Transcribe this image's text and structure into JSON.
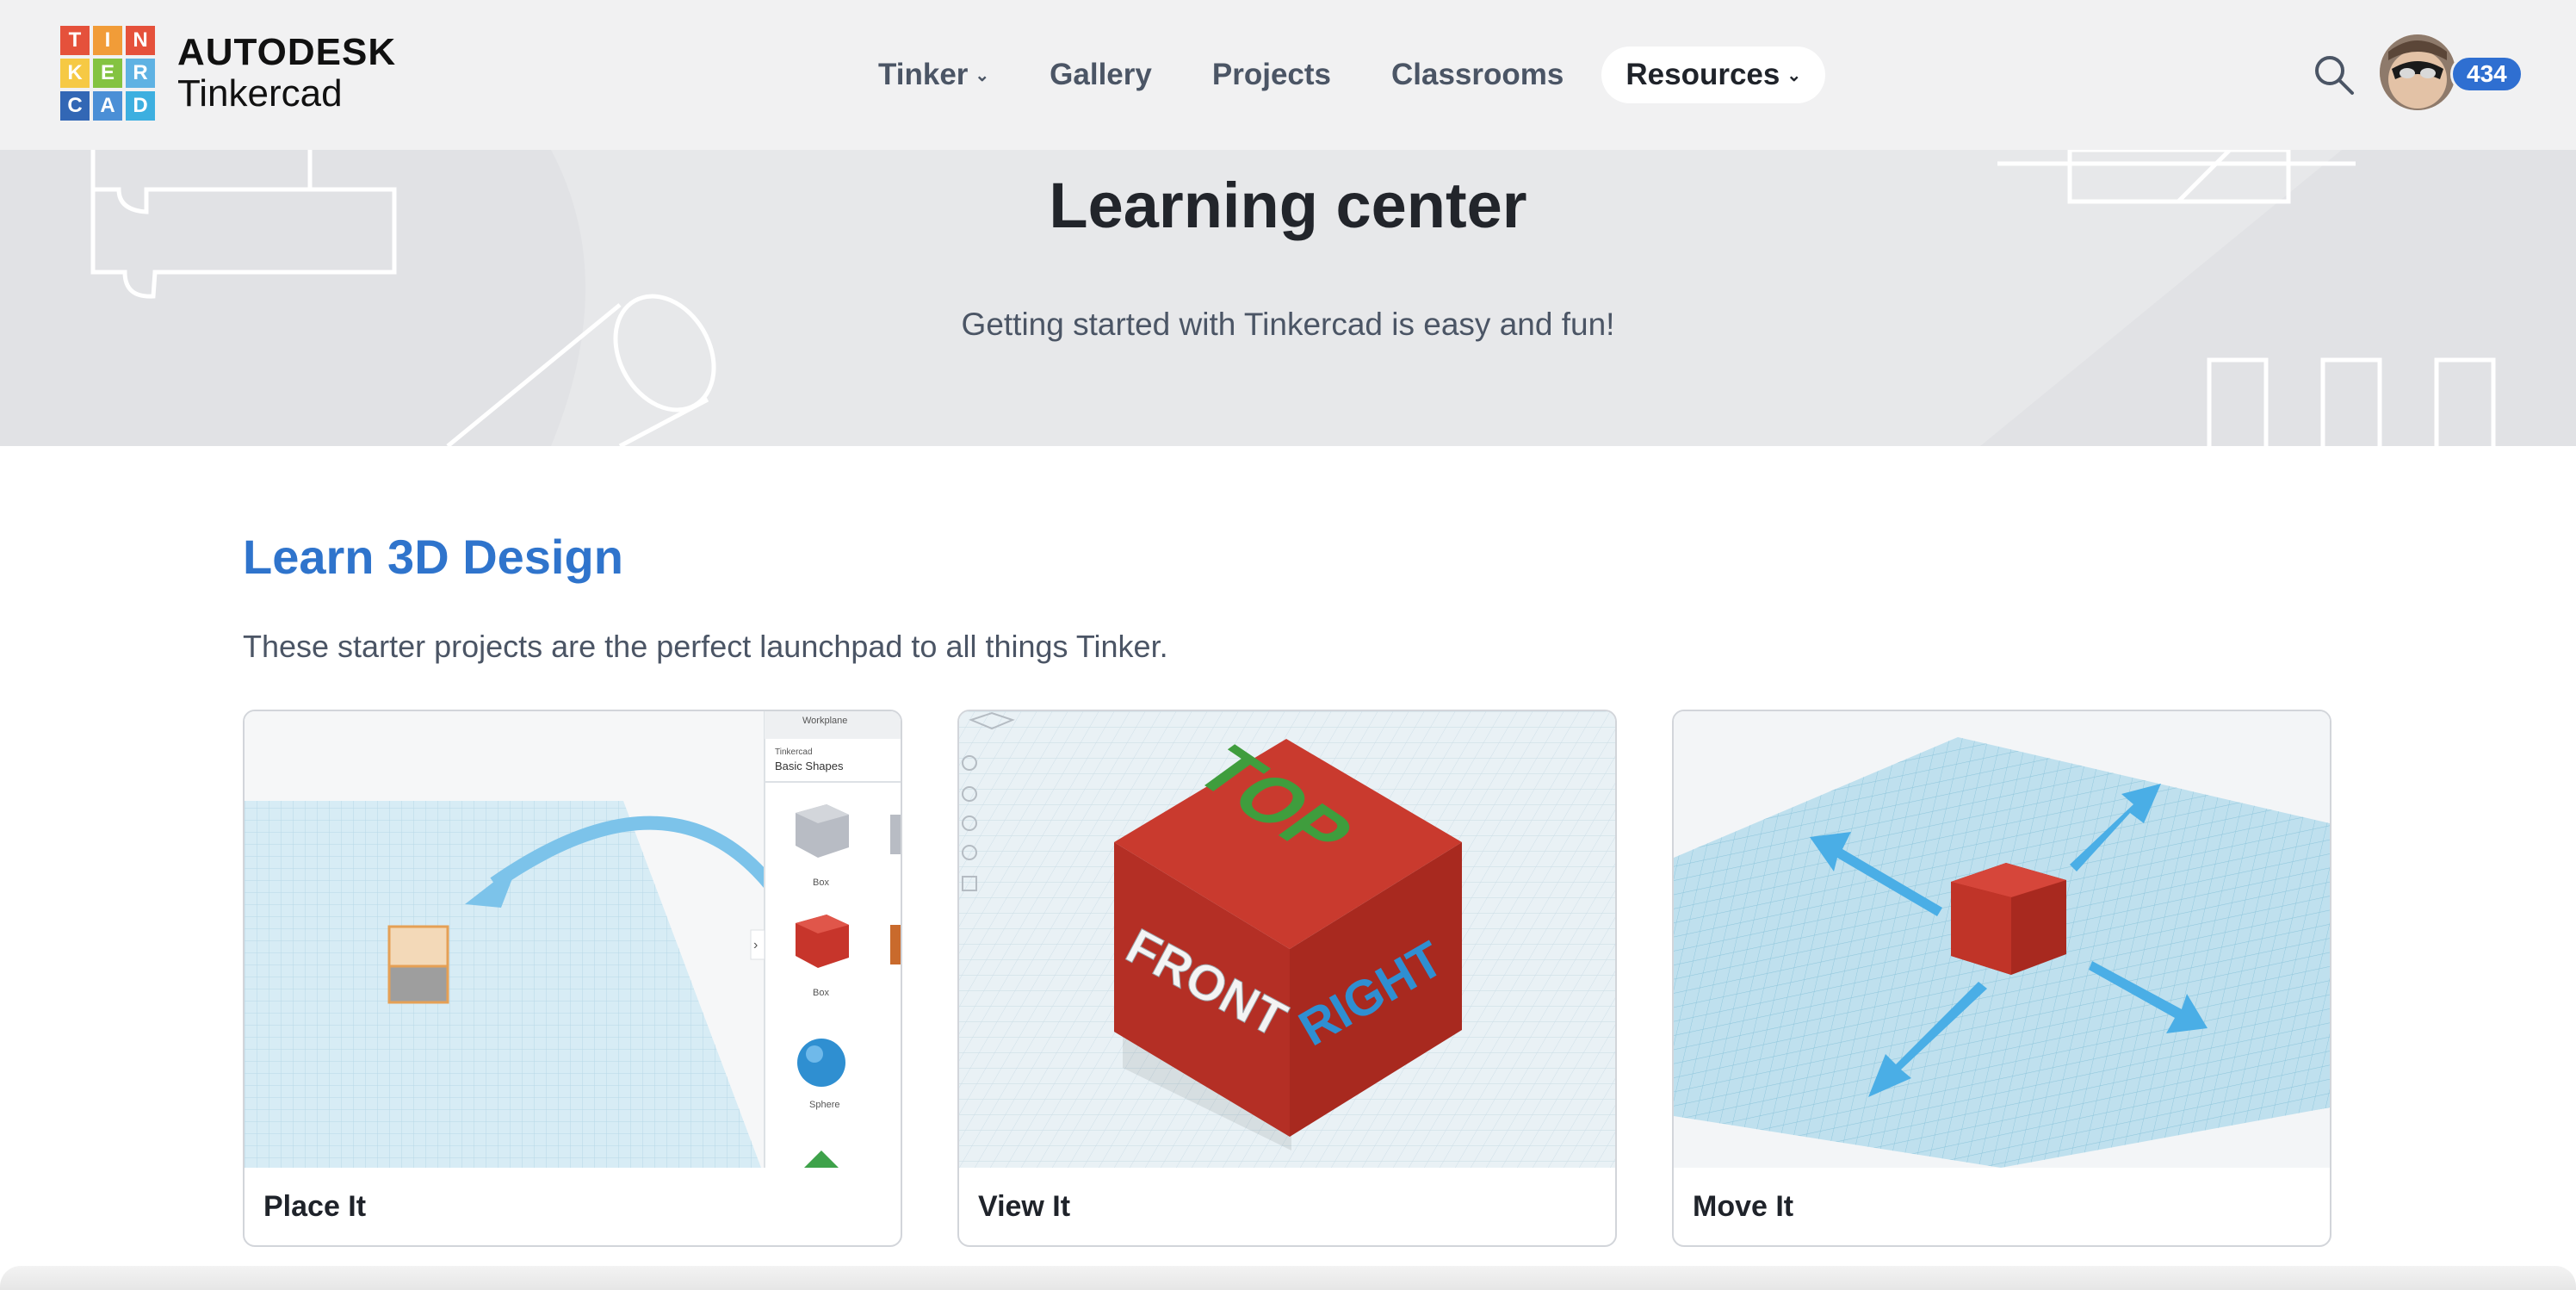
{
  "nav": {
    "logo": {
      "letters": [
        "T",
        "I",
        "N",
        "K",
        "E",
        "R",
        "C",
        "A",
        "D"
      ],
      "brand": "AUTODESK",
      "product": "Tinkercad"
    },
    "menu": [
      {
        "label": "Tinker",
        "dropdown": true
      },
      {
        "label": "Gallery",
        "dropdown": false
      },
      {
        "label": "Projects",
        "dropdown": false
      },
      {
        "label": "Classrooms",
        "dropdown": false
      },
      {
        "label": "Resources",
        "dropdown": true,
        "active": true
      }
    ],
    "search_icon": "search-icon",
    "badge_count": "434"
  },
  "hero": {
    "title": "Learning center",
    "subtitle": "Getting started with Tinkercad is easy and fun!"
  },
  "learn": {
    "title": "Learn 3D Design",
    "description": "These starter projects are the perfect launchpad to all things Tinker.",
    "cards": [
      {
        "label": "Place It",
        "panel": {
          "workplane": "Workplane",
          "source": "Tinkercad",
          "category": "Basic Shapes",
          "shapes": [
            "Box",
            "Box",
            "Sphere"
          ]
        }
      },
      {
        "label": "View It",
        "cube_faces": [
          "TOP",
          "FRONT",
          "RIGHT"
        ]
      },
      {
        "label": "Move It"
      }
    ]
  },
  "colors": {
    "accent": "#2f74cc",
    "badge": "#2f6fd1",
    "cube_red": "#c93a2e",
    "arrow_blue": "#4db3ea",
    "logo": [
      "#e5513b",
      "#f19c38",
      "#f6c944",
      "#84c341",
      "#5fb2e3",
      "#3a7ac4",
      "#3267b5",
      "#4b8fd6",
      "#3dafe0"
    ]
  }
}
